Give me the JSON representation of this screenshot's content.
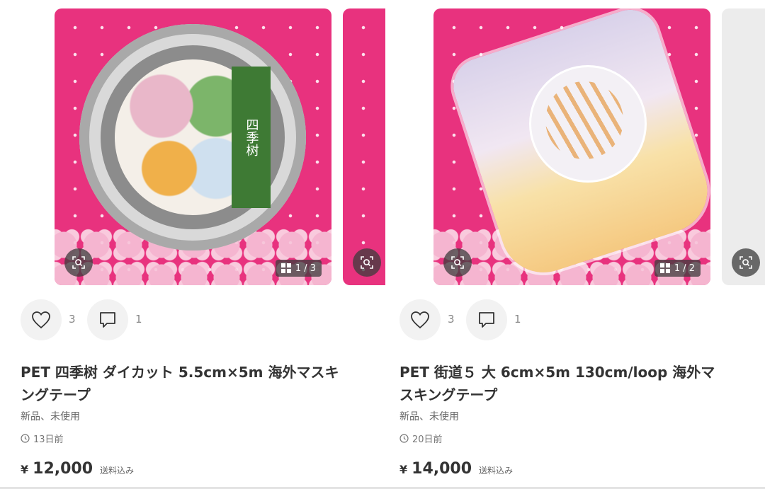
{
  "items": [
    {
      "image_counter": "1 / 3",
      "likes": "3",
      "comments": "1",
      "title": "PET 四季树 ダイカット 5.5cm×5m 海外マスキングテープ",
      "condition": "新品、未使用",
      "posted": "13日前",
      "currency": "¥",
      "price": "12,000",
      "shipping": "送料込み",
      "tape_label": "四季树"
    },
    {
      "image_counter": "1 / 2",
      "likes": "3",
      "comments": "1",
      "title": "PET 街道５ 大 6cm×5m 130cm/loop 海外マスキングテープ",
      "condition": "新品、未使用",
      "posted": "20日前",
      "currency": "¥",
      "price": "14,000",
      "shipping": "送料込み"
    }
  ],
  "colors": {
    "photo_bg": "#e8327e",
    "icon_bg": "#f2f2f2",
    "text": "#333333"
  },
  "icons": [
    "lens-search-icon",
    "grid-icon",
    "heart-icon",
    "comment-icon",
    "clock-icon"
  ]
}
